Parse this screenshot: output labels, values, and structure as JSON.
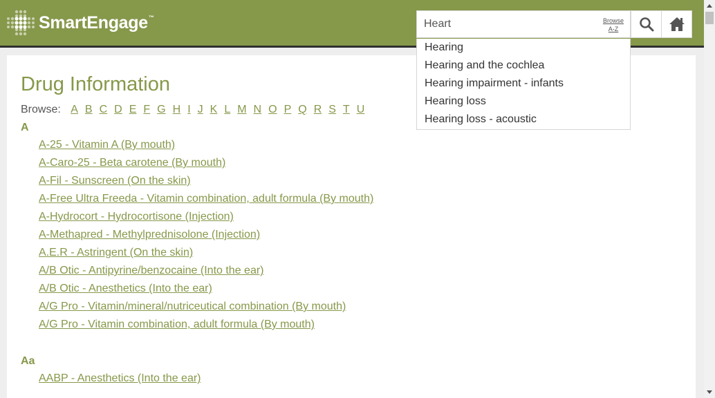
{
  "header": {
    "brand": "SmartEngage",
    "brand_tm": "™"
  },
  "search": {
    "value": "Heart",
    "browse_line1": "Browse",
    "browse_line2": "A-Z",
    "suggestions": [
      "Hearing",
      "Hearing and the cochlea",
      "Hearing impairment - infants",
      "Hearing loss",
      "Hearing loss - acoustic"
    ]
  },
  "page": {
    "title": "Drug Information",
    "browse_label": "Browse:",
    "letters": [
      "A",
      "B",
      "C",
      "D",
      "E",
      "F",
      "G",
      "H",
      "I",
      "J",
      "K",
      "L",
      "M",
      "N",
      "O",
      "P",
      "Q",
      "R",
      "S",
      "T",
      "U"
    ]
  },
  "sections": [
    {
      "heading": "A",
      "items": [
        "A-25 - Vitamin A (By mouth)",
        "A-Caro-25 - Beta carotene (By mouth)",
        "A-Fil - Sunscreen (On the skin)",
        "A-Free Ultra Freeda - Vitamin combination, adult formula (By mouth)",
        "A-Hydrocort - Hydrocortisone (Injection)",
        "A-Methapred - Methylprednisolone (Injection)",
        "A.E.R - Astringent (On the skin)",
        "A/B Otic - Antipyrine/benzocaine (Into the ear)",
        "A/B Otic - Anesthetics (Into the ear)",
        "A/G Pro - Vitamin/mineral/nutriceutical combination (By mouth)",
        "A/G Pro - Vitamin combination, adult formula (By mouth)"
      ]
    },
    {
      "heading": "Aa",
      "items": [
        "AABP - Anesthetics (Into the ear)"
      ]
    }
  ],
  "colors": {
    "brand": "#86984a",
    "rule": "#2f2f2f",
    "text": "#333333"
  },
  "icons": {
    "search": "magnifier",
    "home": "house",
    "logo": "dotted-cross"
  }
}
